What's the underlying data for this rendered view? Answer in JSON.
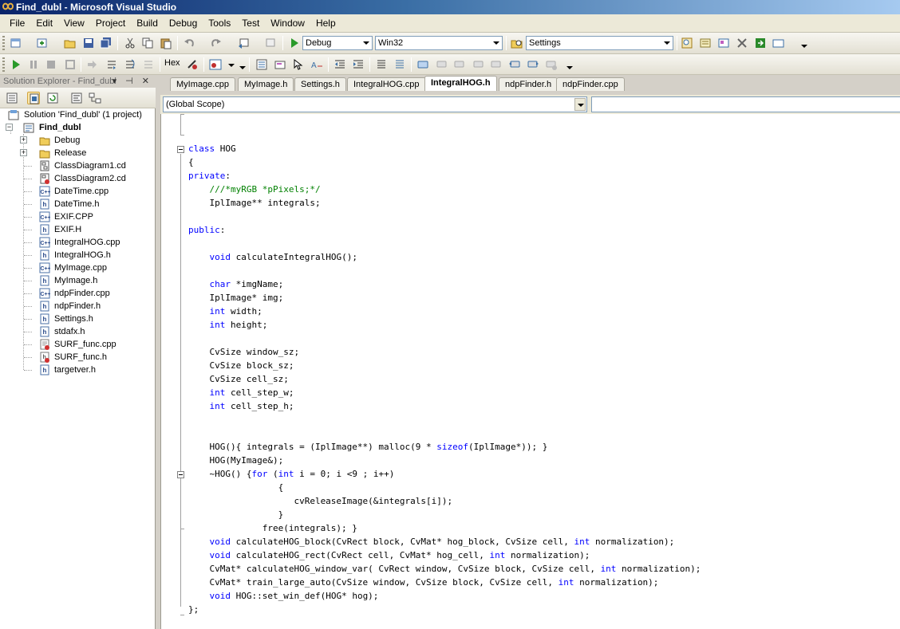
{
  "window": {
    "title": "Find_dubl - Microsoft Visual Studio"
  },
  "menu": [
    "File",
    "Edit",
    "View",
    "Project",
    "Build",
    "Debug",
    "Tools",
    "Test",
    "Window",
    "Help"
  ],
  "toolbar": {
    "config": "Debug",
    "platform": "Win32",
    "find_combo": "Settings",
    "hex_label": "Hex"
  },
  "solution_explorer": {
    "title": "Solution Explorer - Find_dubl",
    "header_buttons": "▾ ⊣ ✕",
    "solution": "Solution 'Find_dubl' (1 project)",
    "project": "Find_dubl",
    "items": [
      {
        "label": "Debug",
        "icon": "folder-icon"
      },
      {
        "label": "Release",
        "icon": "folder-icon"
      },
      {
        "label": "ClassDiagram1.cd",
        "icon": "class-diagram-icon"
      },
      {
        "label": "ClassDiagram2.cd",
        "icon": "class-diagram-excluded-icon"
      },
      {
        "label": "DateTime.cpp",
        "icon": "cpp-file-icon"
      },
      {
        "label": "DateTime.h",
        "icon": "header-file-icon"
      },
      {
        "label": "EXIF.CPP",
        "icon": "cpp-file-icon"
      },
      {
        "label": "EXIF.H",
        "icon": "header-file-icon"
      },
      {
        "label": "IntegralHOG.cpp",
        "icon": "cpp-file-icon"
      },
      {
        "label": "IntegralHOG.h",
        "icon": "header-file-icon"
      },
      {
        "label": "MyImage.cpp",
        "icon": "cpp-file-icon"
      },
      {
        "label": "MyImage.h",
        "icon": "header-file-icon"
      },
      {
        "label": "ndpFinder.cpp",
        "icon": "cpp-file-icon"
      },
      {
        "label": "ndpFinder.h",
        "icon": "header-file-icon"
      },
      {
        "label": "Settings.h",
        "icon": "header-file-icon"
      },
      {
        "label": "stdafx.h",
        "icon": "header-file-icon"
      },
      {
        "label": "SURF_func.cpp",
        "icon": "cpp-file-excluded-icon"
      },
      {
        "label": "SURF_func.h",
        "icon": "header-file-excluded-icon"
      },
      {
        "label": "targetver.h",
        "icon": "header-file-icon"
      }
    ]
  },
  "tabs": [
    {
      "label": "MyImage.cpp"
    },
    {
      "label": "MyImage.h"
    },
    {
      "label": "Settings.h"
    },
    {
      "label": "IntegralHOG.cpp"
    },
    {
      "label": "IntegralHOG.h",
      "active": true
    },
    {
      "label": "ndpFinder.h"
    },
    {
      "label": "ndpFinder.cpp"
    }
  ],
  "navbar": {
    "scope": "(Global Scope)"
  },
  "code": [
    [
      {
        "t": ""
      }
    ],
    [
      {
        "t": ""
      }
    ],
    [
      {
        "t": "class",
        "k": "kw"
      },
      {
        "t": " HOG"
      }
    ],
    [
      {
        "t": "{"
      }
    ],
    [
      {
        "t": "private",
        "k": "kw"
      },
      {
        "t": ":"
      }
    ],
    [
      {
        "t": "    "
      },
      {
        "t": "///*myRGB *pPixels;*/",
        "k": "cm"
      }
    ],
    [
      {
        "t": "    IplImage** integrals;"
      }
    ],
    [
      {
        "t": ""
      }
    ],
    [
      {
        "t": "public",
        "k": "kw"
      },
      {
        "t": ":"
      }
    ],
    [
      {
        "t": ""
      }
    ],
    [
      {
        "t": "    "
      },
      {
        "t": "void",
        "k": "kw"
      },
      {
        "t": " calculateIntegralHOG();"
      }
    ],
    [
      {
        "t": ""
      }
    ],
    [
      {
        "t": "    "
      },
      {
        "t": "char",
        "k": "kw"
      },
      {
        "t": " *imgName;"
      }
    ],
    [
      {
        "t": "    IplImage* img;"
      }
    ],
    [
      {
        "t": "    "
      },
      {
        "t": "int",
        "k": "kw"
      },
      {
        "t": " width;"
      }
    ],
    [
      {
        "t": "    "
      },
      {
        "t": "int",
        "k": "kw"
      },
      {
        "t": " height;"
      }
    ],
    [
      {
        "t": ""
      }
    ],
    [
      {
        "t": "    CvSize window_sz;"
      }
    ],
    [
      {
        "t": "    CvSize block_sz;"
      }
    ],
    [
      {
        "t": "    CvSize cell_sz;"
      }
    ],
    [
      {
        "t": "    "
      },
      {
        "t": "int",
        "k": "kw"
      },
      {
        "t": " cell_step_w;"
      }
    ],
    [
      {
        "t": "    "
      },
      {
        "t": "int",
        "k": "kw"
      },
      {
        "t": " cell_step_h;"
      }
    ],
    [
      {
        "t": ""
      }
    ],
    [
      {
        "t": ""
      }
    ],
    [
      {
        "t": "    HOG(){ integrals = (IplImage**) malloc(9 * "
      },
      {
        "t": "sizeof",
        "k": "kw"
      },
      {
        "t": "(IplImage*)); }"
      }
    ],
    [
      {
        "t": "    HOG(MyImage&);"
      }
    ],
    [
      {
        "t": "    ~HOG() {"
      },
      {
        "t": "for",
        "k": "kw"
      },
      {
        "t": " ("
      },
      {
        "t": "int",
        "k": "kw"
      },
      {
        "t": " i = 0; i <9 ; i++)"
      }
    ],
    [
      {
        "t": "                 {"
      }
    ],
    [
      {
        "t": "                    cvReleaseImage(&integrals[i]);"
      }
    ],
    [
      {
        "t": "                 }"
      }
    ],
    [
      {
        "t": "              free(integrals); }"
      }
    ],
    [
      {
        "t": "    "
      },
      {
        "t": "void",
        "k": "kw"
      },
      {
        "t": " calculateHOG_block(CvRect block, CvMat* hog_block, CvSize cell, "
      },
      {
        "t": "int",
        "k": "kw"
      },
      {
        "t": " normalization);"
      }
    ],
    [
      {
        "t": "    "
      },
      {
        "t": "void",
        "k": "kw"
      },
      {
        "t": " calculateHOG_rect(CvRect cell, CvMat* hog_cell, "
      },
      {
        "t": "int",
        "k": "kw"
      },
      {
        "t": " normalization);"
      }
    ],
    [
      {
        "t": "    CvMat* calculateHOG_window_var( CvRect window, CvSize block, CvSize cell, "
      },
      {
        "t": "int",
        "k": "kw"
      },
      {
        "t": " normalization);"
      }
    ],
    [
      {
        "t": "    CvMat* train_large_auto(CvSize window, CvSize block, CvSize cell, "
      },
      {
        "t": "int",
        "k": "kw"
      },
      {
        "t": " normalization);"
      }
    ],
    [
      {
        "t": "    "
      },
      {
        "t": "void",
        "k": "kw"
      },
      {
        "t": " HOG::set_win_def(HOG* hog);"
      }
    ],
    [
      {
        "t": "};"
      }
    ]
  ],
  "colors": {
    "keyword": "#0000ff",
    "comment": "#008000",
    "titlebar": "#0a246a"
  }
}
